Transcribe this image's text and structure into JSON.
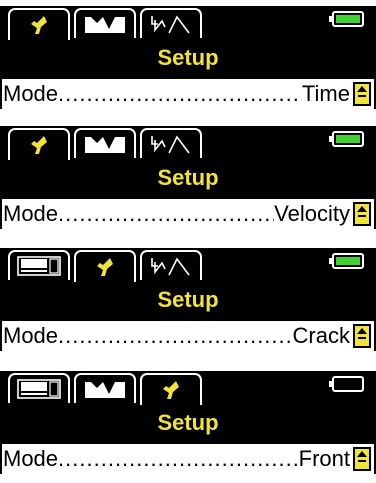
{
  "colors": {
    "background": "#000000",
    "accent_yellow": "#f2e23c",
    "battery_green": "#3fd12f",
    "row_background": "#ffffff"
  },
  "panels": [
    {
      "tabs": [
        {
          "icon": "wrench-icon",
          "active": true
        },
        {
          "icon": "waveform-icon",
          "active": false
        },
        {
          "icon": "sweep-icon",
          "active": false
        }
      ],
      "battery_level": 0.85,
      "title": "Setup",
      "mode_label": "Mode",
      "mode_value": "Time"
    },
    {
      "tabs": [
        {
          "icon": "wrench-icon",
          "active": true
        },
        {
          "icon": "waveform-icon",
          "active": false
        },
        {
          "icon": "sweep-icon",
          "active": false
        }
      ],
      "battery_level": 0.85,
      "title": "Setup",
      "mode_label": "Mode",
      "mode_value": "Velocity"
    },
    {
      "tabs": [
        {
          "icon": "display-icon",
          "active": false
        },
        {
          "icon": "wrench-icon",
          "active": true
        },
        {
          "icon": "sweep-icon",
          "active": false
        }
      ],
      "battery_level": 0.85,
      "title": "Setup",
      "mode_label": "Mode",
      "mode_value": "Crack"
    },
    {
      "tabs": [
        {
          "icon": "display-icon",
          "active": false
        },
        {
          "icon": "waveform-icon",
          "active": false
        },
        {
          "icon": "wrench-icon",
          "active": true
        }
      ],
      "battery_level": 0.0,
      "title": "Setup",
      "mode_label": "Mode",
      "mode_value": "Front"
    }
  ]
}
